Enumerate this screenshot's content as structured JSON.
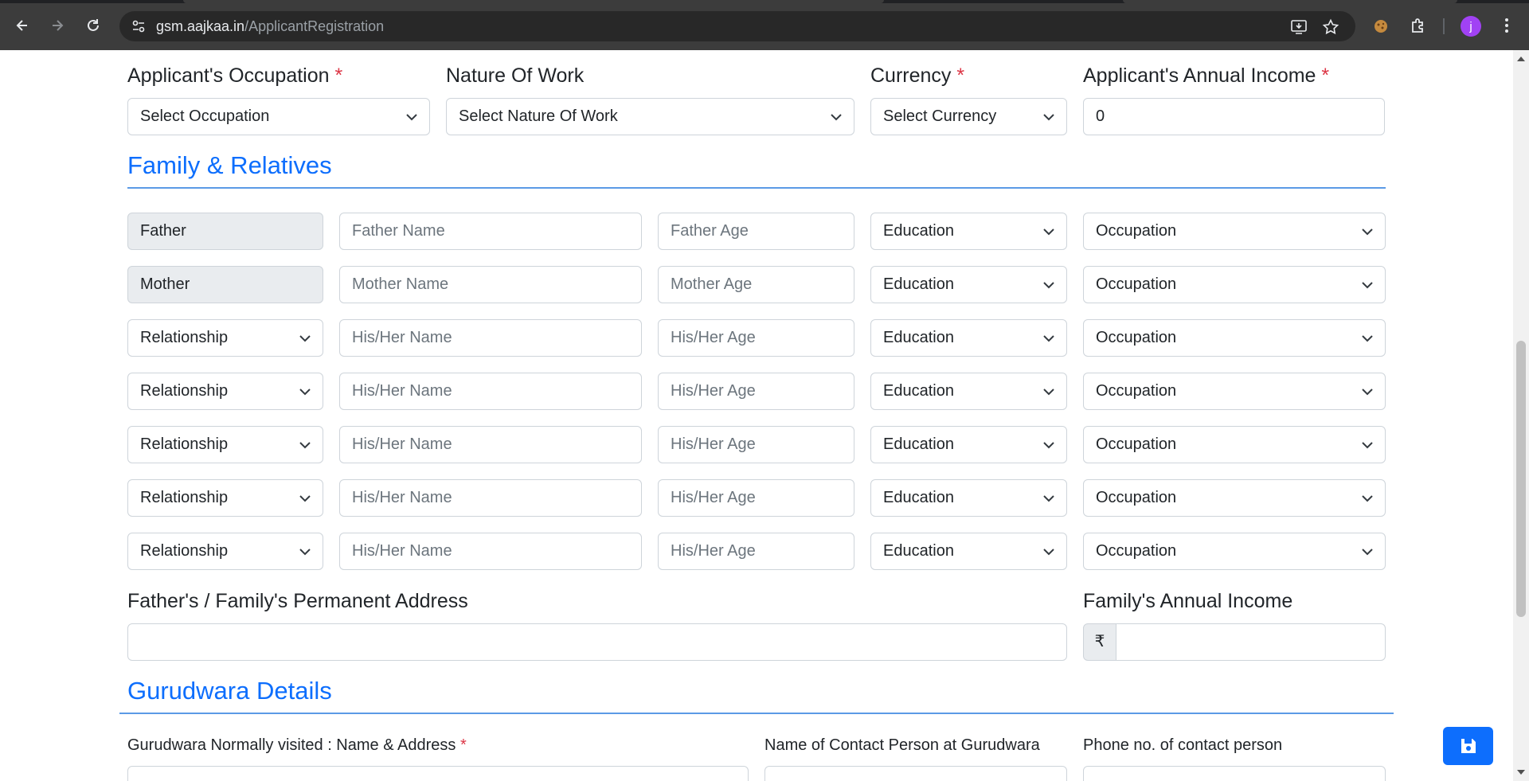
{
  "browser": {
    "url_host": "gsm.aajkaa.in",
    "url_path": "/ApplicantRegistration",
    "profile_initial": "j"
  },
  "applicant": {
    "occupation_label": "Applicant's Occupation",
    "occupation_value": "Select Occupation",
    "nature_of_work_label": "Nature Of Work",
    "nature_of_work_value": "Select Nature Of Work",
    "currency_label": "Currency",
    "currency_value": "Select Currency",
    "annual_income_label": "Applicant's Annual Income",
    "annual_income_value": "0",
    "required_mark": "*"
  },
  "family": {
    "section_title": "Family & Relatives",
    "rows": [
      {
        "relation": "Father",
        "relation_type": "readonly",
        "name_placeholder": "Father Name",
        "age_placeholder": "Father Age",
        "education": "Education",
        "occupation": "Occupation"
      },
      {
        "relation": "Mother",
        "relation_type": "readonly",
        "name_placeholder": "Mother Name",
        "age_placeholder": "Mother Age",
        "education": "Education",
        "occupation": "Occupation"
      },
      {
        "relation": "Relationship",
        "relation_type": "select",
        "name_placeholder": "His/Her Name",
        "age_placeholder": "His/Her Age",
        "education": "Education",
        "occupation": "Occupation"
      },
      {
        "relation": "Relationship",
        "relation_type": "select",
        "name_placeholder": "His/Her Name",
        "age_placeholder": "His/Her Age",
        "education": "Education",
        "occupation": "Occupation"
      },
      {
        "relation": "Relationship",
        "relation_type": "select",
        "name_placeholder": "His/Her Name",
        "age_placeholder": "His/Her Age",
        "education": "Education",
        "occupation": "Occupation"
      },
      {
        "relation": "Relationship",
        "relation_type": "select",
        "name_placeholder": "His/Her Name",
        "age_placeholder": "His/Her Age",
        "education": "Education",
        "occupation": "Occupation"
      },
      {
        "relation": "Relationship",
        "relation_type": "select",
        "name_placeholder": "His/Her Name",
        "age_placeholder": "His/Her Age",
        "education": "Education",
        "occupation": "Occupation"
      }
    ],
    "address_label": "Father's / Family's Permanent Address",
    "address_value": "",
    "income_label": "Family's Annual Income",
    "income_prefix": "₹",
    "income_value": ""
  },
  "gurudwara": {
    "section_title": "Gurudwara Details",
    "name_address_label": "Gurudwara Normally visited : Name & Address",
    "contact_person_label": "Name of Contact Person at Gurudwara",
    "phone_label": "Phone no. of contact person"
  },
  "colors": {
    "accent": "#0d6efd",
    "required": "#dc3545",
    "rule": "#5b9ae6"
  }
}
